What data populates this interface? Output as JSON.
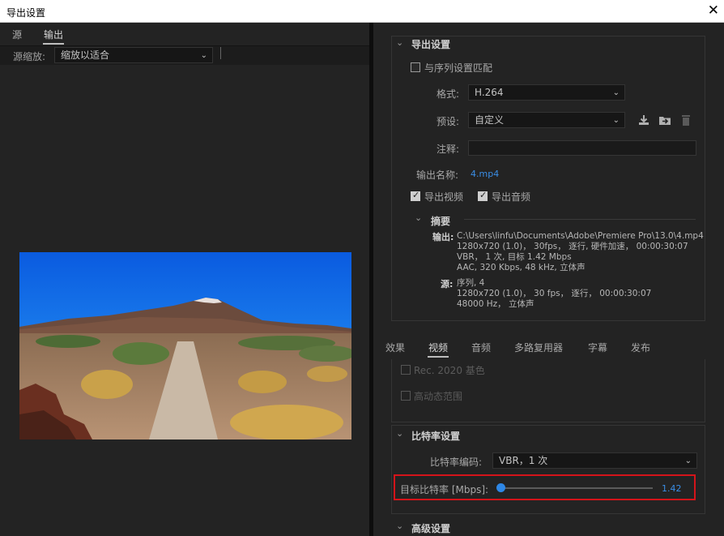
{
  "window": {
    "title": "导出设置",
    "close": "✕"
  },
  "left": {
    "tabs": [
      {
        "label": "源"
      },
      {
        "label": "输出"
      }
    ],
    "scale_label": "源缩放:",
    "scale_value": "缩放以适合"
  },
  "export": {
    "header": "导出设置",
    "match_sequence": "与序列设置匹配",
    "format_label": "格式:",
    "format_value": "H.264",
    "preset_label": "预设:",
    "preset_value": "自定义",
    "comment_label": "注释:",
    "output_name_label": "输出名称:",
    "output_name_value": "4.mp4",
    "export_video": "导出视频",
    "export_audio": "导出音频",
    "summary": {
      "header": "摘要",
      "output_label": "输出:",
      "output_lines": [
        "C:\\Users\\linfu\\Documents\\Adobe\\Premiere Pro\\13.0\\4.mp4",
        "1280x720 (1.0)， 30fps， 逐行, 硬件加速， 00:00:30:07",
        "VBR， 1 次, 目标 1.42 Mbps",
        "AAC, 320 Kbps, 48  kHz, 立体声"
      ],
      "source_label": "源:",
      "source_lines": [
        "序列, 4",
        "1280x720 (1.0)， 30 fps， 逐行， 00:00:30:07",
        "48000 Hz， 立体声"
      ]
    }
  },
  "bottom_tabs": [
    "效果",
    "视频",
    "音频",
    "多路复用器",
    "字幕",
    "发布"
  ],
  "video": {
    "rec2020": "Rec. 2020 基色",
    "hdr": "高动态范围"
  },
  "bitrate": {
    "header": "比特率设置",
    "encoding_label": "比特率编码:",
    "encoding_value": "VBR，1 次",
    "target_label": "目标比特率 [Mbps]:",
    "target_value": "1.42",
    "slider_fraction": 0.0
  },
  "advanced": {
    "header": "高级设置"
  },
  "colors": {
    "accent": "#2e87e6",
    "highlight": "#d4141a"
  }
}
